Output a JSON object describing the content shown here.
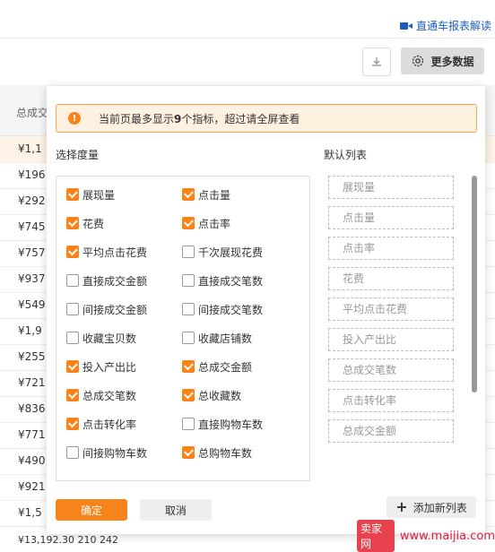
{
  "header": {
    "help_link": "直通车报表解读"
  },
  "toolbar": {
    "more_data_label": "更多数据"
  },
  "table": {
    "header": "总成交",
    "rows": [
      "¥1,1",
      "¥196",
      "¥292",
      "¥745",
      "¥757",
      "¥937",
      "¥549",
      "¥1,9",
      "¥255",
      "¥721",
      "¥836",
      "¥771",
      "¥490",
      "¥921",
      "¥1,5"
    ],
    "tail": "¥13,192.30    210    242"
  },
  "panel": {
    "notice_prefix": "当前页最多显示",
    "notice_count": "9",
    "notice_suffix": "个指标，超过请全屏查看",
    "select_title": "选择度量",
    "default_title": "默认列表",
    "metrics": [
      {
        "label": "展现量",
        "checked": true
      },
      {
        "label": "点击量",
        "checked": true
      },
      {
        "label": "花费",
        "checked": true
      },
      {
        "label": "点击率",
        "checked": true
      },
      {
        "label": "平均点击花费",
        "checked": true
      },
      {
        "label": "千次展现花费",
        "checked": false
      },
      {
        "label": "直接成交金额",
        "checked": false
      },
      {
        "label": "直接成交笔数",
        "checked": false
      },
      {
        "label": "间接成交金额",
        "checked": false
      },
      {
        "label": "间接成交笔数",
        "checked": false
      },
      {
        "label": "收藏宝贝数",
        "checked": false
      },
      {
        "label": "收藏店铺数",
        "checked": false
      },
      {
        "label": "投入产出比",
        "checked": true
      },
      {
        "label": "总成交金额",
        "checked": true
      },
      {
        "label": "总成交笔数",
        "checked": true
      },
      {
        "label": "总收藏数",
        "checked": true
      },
      {
        "label": "点击转化率",
        "checked": true
      },
      {
        "label": "直接购物车数",
        "checked": false
      },
      {
        "label": "间接购物车数",
        "checked": false
      },
      {
        "label": "总购物车数",
        "checked": true
      }
    ],
    "default_list": [
      "展现量",
      "点击量",
      "点击率",
      "花费",
      "平均点击花费",
      "投入产出比",
      "总成交笔数",
      "点击转化率",
      "总成交金额"
    ],
    "ok_label": "确定",
    "cancel_label": "取消",
    "add_list_label": "添加新列表"
  },
  "watermark": {
    "brand": "卖家网",
    "url": "www.maijia.com"
  },
  "colors": {
    "accent": "#f7841a",
    "link": "#1a5dbf",
    "notice_bg": "#fff1e0"
  }
}
